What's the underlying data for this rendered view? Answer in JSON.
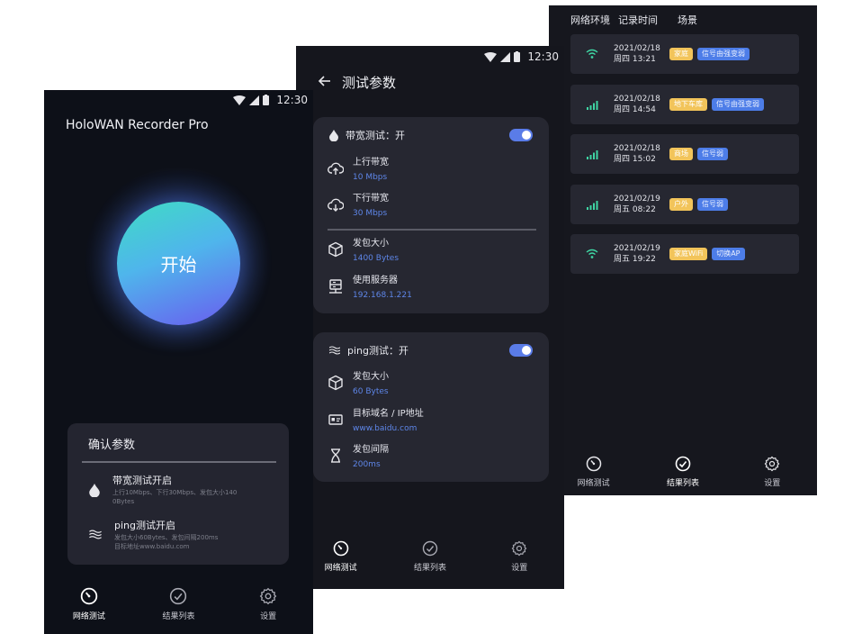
{
  "status": {
    "time": "12:30"
  },
  "nav": {
    "test": "网络测试",
    "results": "结果列表",
    "settings": "设置"
  },
  "screen1": {
    "app_title": "HoloWAN Recorder Pro",
    "start_label": "开始",
    "confirm": {
      "title": "确认参数",
      "items": [
        {
          "title": "带宽测试开启",
          "desc": "上行10Mbps、下行30Mbps、发包大小140 0Bytes"
        },
        {
          "title": "ping测试开启",
          "desc1": "发包大小60Bytes、发包间隔200ms",
          "desc2": "目标地址www.baidu.com"
        }
      ]
    }
  },
  "screen2": {
    "title": "测试参数",
    "bandwidth": {
      "header": "带宽测试：开",
      "up": {
        "label": "上行带宽",
        "value": "10 Mbps"
      },
      "down": {
        "label": "下行带宽",
        "value": "30 Mbps"
      },
      "size": {
        "label": "发包大小",
        "value": "1400 Bytes"
      },
      "server": {
        "label": "使用服务器",
        "value": "192.168.1.221"
      }
    },
    "ping": {
      "header": "ping测试：开",
      "size": {
        "label": "发包大小",
        "value": "60 Bytes"
      },
      "target": {
        "label": "目标域名 / IP地址",
        "value": "www.baidu.com"
      },
      "interval": {
        "label": "发包间隔",
        "value": "200ms"
      }
    }
  },
  "screen3": {
    "headers": {
      "env": "网络环境",
      "time": "记录时间",
      "scene": "场景"
    },
    "records": [
      {
        "signal": "wifi",
        "date": "2021/02/18",
        "time": "周四 13:21",
        "tags": [
          {
            "text": "家庭",
            "color": "yellow"
          },
          {
            "text": "信号由强变弱",
            "color": "blue"
          }
        ]
      },
      {
        "signal": "cell",
        "date": "2021/02/18",
        "time": "周四 14:54",
        "tags": [
          {
            "text": "地下车库",
            "color": "yellow"
          },
          {
            "text": "信号由强变弱",
            "color": "blue"
          }
        ]
      },
      {
        "signal": "cell",
        "date": "2021/02/18",
        "time": "周四 15:02",
        "tags": [
          {
            "text": "商场",
            "color": "yellow"
          },
          {
            "text": "信号弱",
            "color": "blue"
          }
        ]
      },
      {
        "signal": "cell",
        "date": "2021/02/19",
        "time": "周五 08:22",
        "tags": [
          {
            "text": "户外",
            "color": "yellow"
          },
          {
            "text": "信号弱",
            "color": "blue"
          }
        ]
      },
      {
        "signal": "wifi",
        "date": "2021/02/19",
        "time": "周五 19:22",
        "tags": [
          {
            "text": "家庭WiFi",
            "color": "yellow"
          },
          {
            "text": "切换AP",
            "color": "blue"
          }
        ]
      }
    ]
  },
  "colors": {
    "accent": "#5a7ce8",
    "tag_yellow": "#f2c45a",
    "tag_blue": "#4d7de8",
    "signal": "#3fd6a4"
  }
}
